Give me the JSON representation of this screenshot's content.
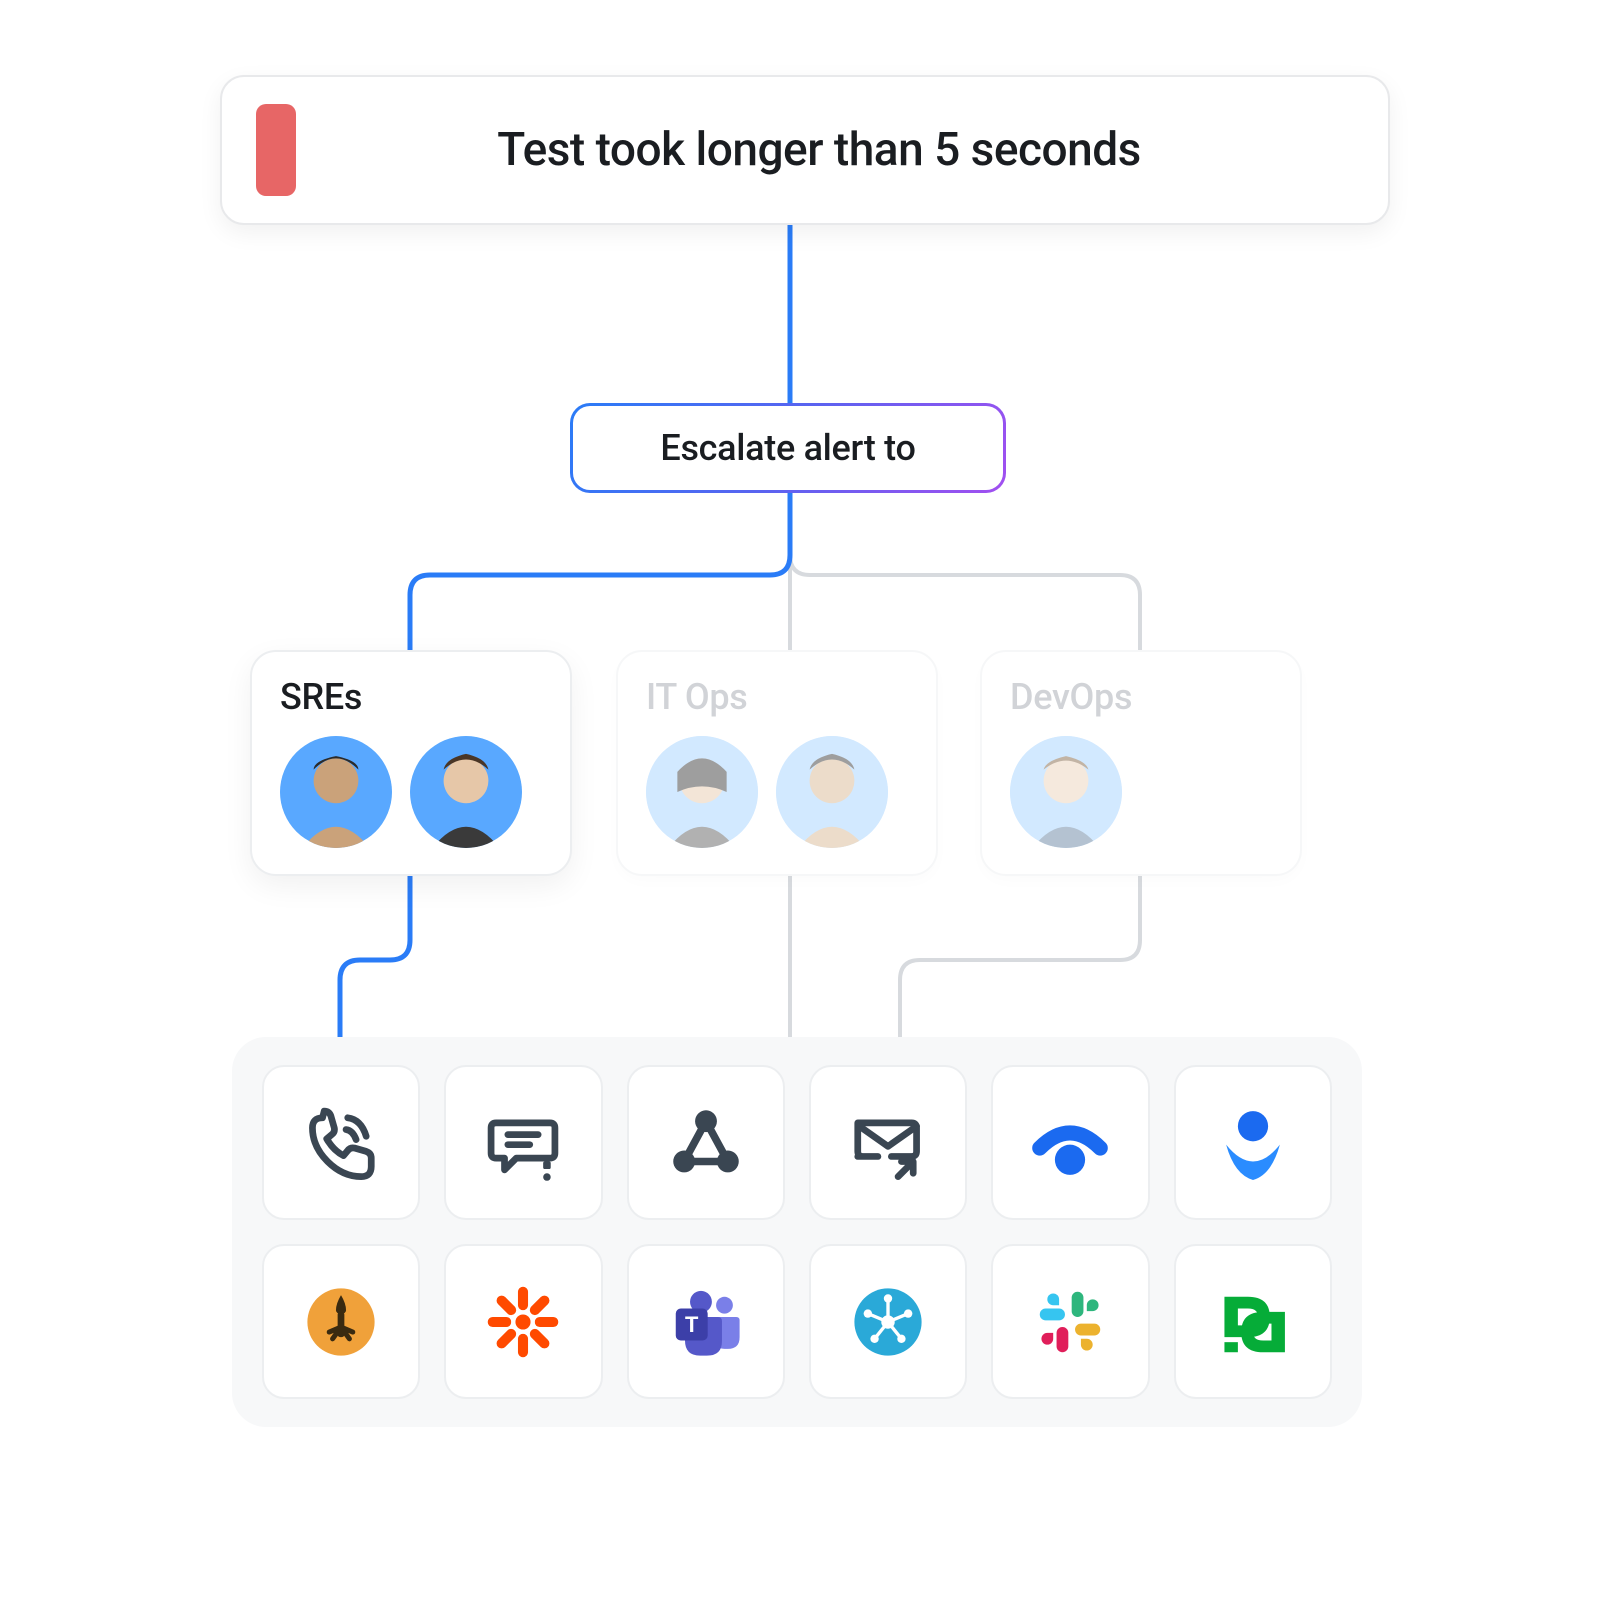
{
  "alert": {
    "title": "Test took longer than 5 seconds",
    "badge_color": "#e76666"
  },
  "escalate": {
    "label": "Escalate alert to"
  },
  "teams": [
    {
      "id": "sres",
      "label": "SREs",
      "active": true,
      "avatars": 2
    },
    {
      "id": "itops",
      "label": "IT Ops",
      "active": false,
      "avatars": 2
    },
    {
      "id": "devops",
      "label": "DevOps",
      "active": false,
      "avatars": 1
    }
  ],
  "channels": [
    {
      "id": "phone",
      "name": "phone-call-icon"
    },
    {
      "id": "sms",
      "name": "sms-chat-icon"
    },
    {
      "id": "webhook",
      "name": "webhook-icon"
    },
    {
      "id": "email",
      "name": "email-share-icon"
    },
    {
      "id": "statuspage",
      "name": "statuspage-icon"
    },
    {
      "id": "opsgenie",
      "name": "opsgenie-icon"
    },
    {
      "id": "firehydrant",
      "name": "firehydrant-icon"
    },
    {
      "id": "zapier",
      "name": "zapier-icon"
    },
    {
      "id": "msteams",
      "name": "microsoft-teams-icon"
    },
    {
      "id": "ilert",
      "name": "ilert-icon"
    },
    {
      "id": "slack",
      "name": "slack-icon"
    },
    {
      "id": "pagerduty",
      "name": "pagerduty-icon"
    }
  ],
  "colors": {
    "accent_blue": "#2a7cf7",
    "faded_line": "#d7dade"
  }
}
